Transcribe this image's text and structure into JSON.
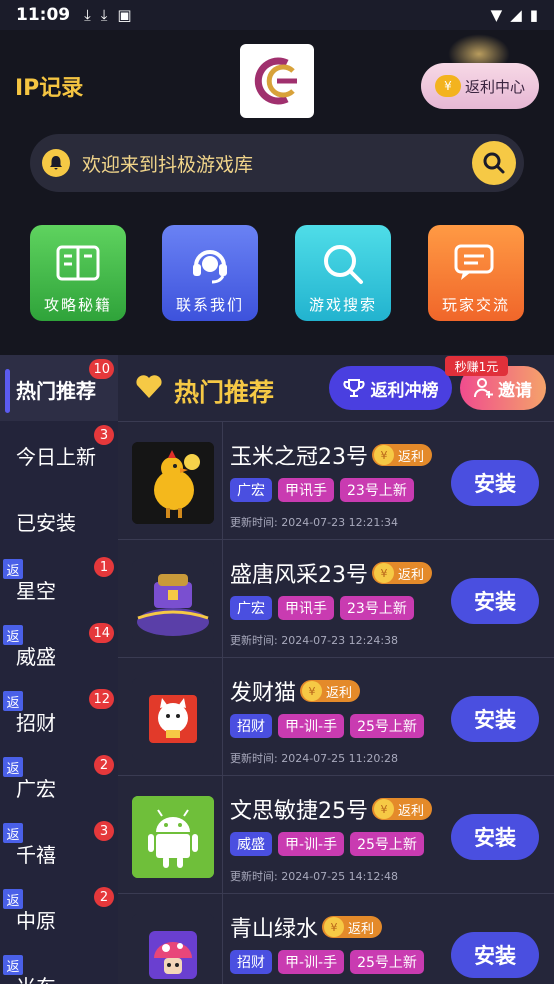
{
  "status": {
    "time": "11:09"
  },
  "header": {
    "ip_title": "IP记录",
    "rebate_center": "返利中心",
    "search_text": "欢迎来到抖极游戏库"
  },
  "shortcuts": [
    {
      "label": "攻略秘籍",
      "icon": "book-icon",
      "color": "#3fbf4a"
    },
    {
      "label": "联系我们",
      "icon": "headset-icon",
      "color": "#4a60e8"
    },
    {
      "label": "游戏搜索",
      "icon": "search-icon",
      "color": "#2ec4d8"
    },
    {
      "label": "玩家交流",
      "icon": "chat-icon",
      "color": "#f47a2a"
    }
  ],
  "sidebar": {
    "items": [
      {
        "label": "热门推荐",
        "badge": "10",
        "rebate": ""
      },
      {
        "label": "今日上新",
        "badge": "3",
        "rebate": ""
      },
      {
        "label": "已安装",
        "badge": "",
        "rebate": ""
      },
      {
        "label": "星空",
        "badge": "1",
        "rebate": "返"
      },
      {
        "label": "威盛",
        "badge": "14",
        "rebate": "返"
      },
      {
        "label": "招财",
        "badge": "12",
        "rebate": "返"
      },
      {
        "label": "广宏",
        "badge": "2",
        "rebate": "返"
      },
      {
        "label": "千禧",
        "badge": "3",
        "rebate": "返"
      },
      {
        "label": "中原",
        "badge": "2",
        "rebate": "返"
      },
      {
        "label": "米东",
        "badge": "",
        "rebate": "返"
      }
    ]
  },
  "main": {
    "title": "热门推荐",
    "rank_button": "返利冲榜",
    "invite_button": "邀请",
    "earn_tag": "秒赚1元",
    "rebate_label": "返利",
    "yen": "¥",
    "install_label": "安装",
    "games": [
      {
        "name": "玉米之冠23号",
        "tags": [
          "广宏",
          "甲讯手",
          "23号上新"
        ],
        "updated": "更新时间: 2024-07-23 12:21:34",
        "thumb": "chicken"
      },
      {
        "name": "盛唐风采23号",
        "tags": [
          "广宏",
          "甲讯手",
          "23号上新"
        ],
        "updated": "更新时间: 2024-07-23 12:24:38",
        "thumb": "chest"
      },
      {
        "name": "发财猫",
        "tags": [
          "招财",
          "甲-训-手",
          "25号上新"
        ],
        "updated": "更新时间: 2024-07-25 11:20:28",
        "thumb": "cat"
      },
      {
        "name": "文思敏捷25号",
        "tags": [
          "威盛",
          "甲-训-手",
          "25号上新"
        ],
        "updated": "更新时间: 2024-07-25 14:12:48",
        "thumb": "android"
      },
      {
        "name": "青山绿水",
        "tags": [
          "招财",
          "甲-训-手",
          "25号上新"
        ],
        "updated": "",
        "thumb": "mushroom"
      }
    ]
  }
}
